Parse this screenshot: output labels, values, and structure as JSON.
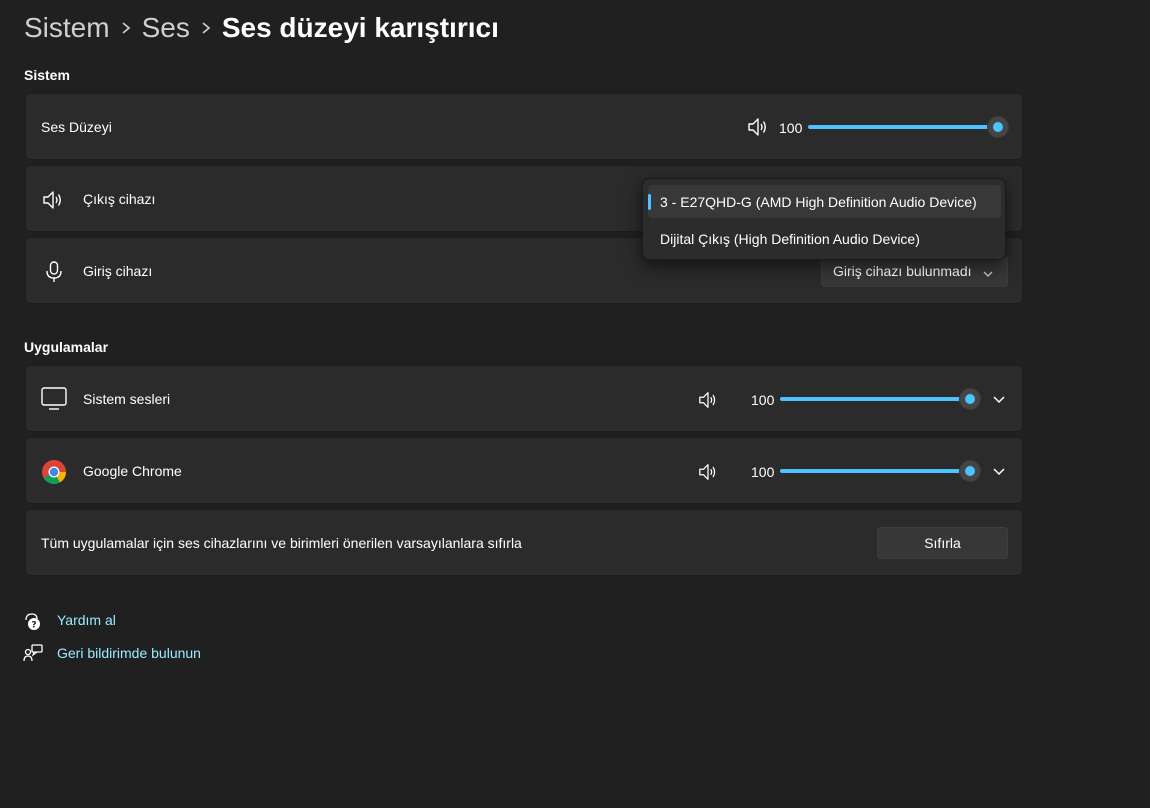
{
  "breadcrumb": {
    "items": [
      "Sistem",
      "Ses"
    ],
    "current": "Ses düzeyi karıştırıcı"
  },
  "system_section": {
    "title": "Sistem",
    "master_volume": {
      "label": "Ses Düzeyi",
      "value": "100",
      "level_percent": 100,
      "icon": "speaker-icon"
    },
    "output_device": {
      "label": "Çıkış cihazı",
      "icon": "speaker-icon"
    },
    "input_device": {
      "label": "Giriş cihazı",
      "selected": "Giriş cihazı bulunmadı",
      "icon": "microphone-icon"
    }
  },
  "output_dropdown": {
    "options": [
      "3 - E27QHD-G (AMD High Definition Audio Device)",
      "Dijital Çıkış (High Definition Audio Device)"
    ],
    "selected_index": 0
  },
  "apps_section": {
    "title": "Uygulamalar",
    "apps": [
      {
        "name": "Sistem sesleri",
        "value": "100",
        "level_percent": 100,
        "icon": "monitor-icon"
      },
      {
        "name": "Google Chrome",
        "value": "100",
        "level_percent": 100,
        "icon": "chrome-icon"
      }
    ],
    "reset": {
      "text": "Tüm uygulamalar için ses cihazlarını ve birimleri önerilen varsayılanlara sıfırla",
      "button": "Sıfırla"
    }
  },
  "links": {
    "help": "Yardım al",
    "feedback": "Geri bildirimde bulunun"
  },
  "colors": {
    "accent": "#4cc2ff",
    "link": "#99ebff",
    "background": "#202020",
    "card": "#2b2b2b"
  }
}
